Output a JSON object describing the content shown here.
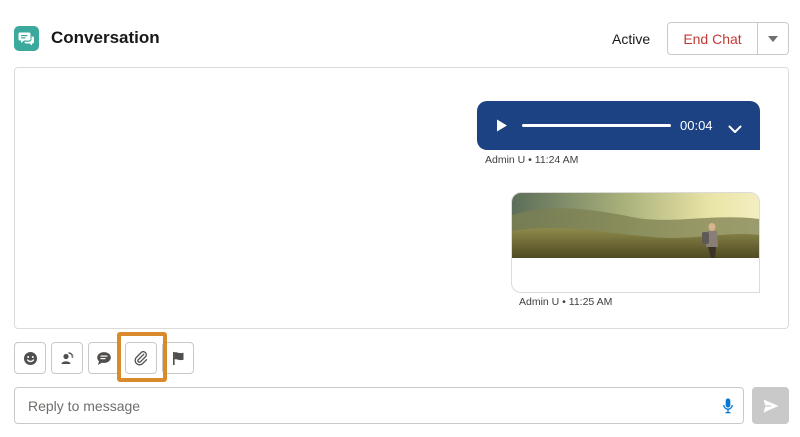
{
  "header": {
    "title": "Conversation",
    "icon": "chat-bubbles-icon",
    "status": "Active",
    "end_chat_label": "End Chat",
    "end_chat_color": "#c23934",
    "menu_icon": "caret-down-icon"
  },
  "messages": [
    {
      "type": "audio",
      "duration": "00:04",
      "bubble_color": "#1d4284",
      "meta": "Admin U • 11:24 AM"
    },
    {
      "type": "image",
      "meta": "Admin U • 11:25 AM"
    }
  ],
  "toolbar": {
    "buttons": [
      {
        "icon": "emoji-icon",
        "highlighted": false
      },
      {
        "icon": "user-transfer-icon",
        "highlighted": false
      },
      {
        "icon": "quick-text-icon",
        "highlighted": false
      },
      {
        "icon": "attachment-icon",
        "highlighted": true
      },
      {
        "icon": "flag-icon",
        "highlighted": false
      }
    ],
    "highlight_color": "#d98a2b"
  },
  "composer": {
    "placeholder": "Reply to message",
    "value": "",
    "mic_icon": "microphone-icon",
    "send_icon": "send-icon"
  }
}
